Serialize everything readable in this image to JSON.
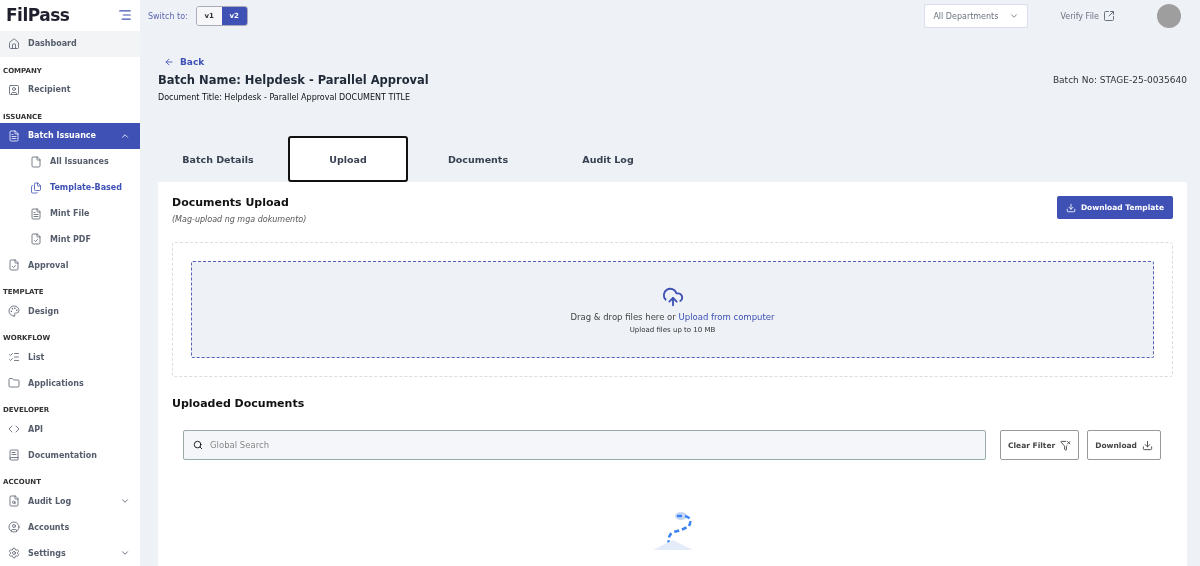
{
  "logo": {
    "text": "FilPass"
  },
  "sidebar": {
    "sections": [
      {
        "items": [
          {
            "label": "Dashboard",
            "selected": false,
            "hovered": true
          }
        ]
      },
      {
        "heading": "COMPANY",
        "items": [
          {
            "label": "Recipient",
            "selected": false
          }
        ]
      },
      {
        "heading": "ISSUANCE",
        "items": [
          {
            "label": "Batch Issuance",
            "selected": true,
            "expanded": true,
            "children": [
              {
                "label": "All Issuances",
                "selected": false
              },
              {
                "label": "Template-Based",
                "selected": true
              },
              {
                "label": "Mint File",
                "selected": false
              },
              {
                "label": "Mint PDF",
                "selected": false
              }
            ]
          },
          {
            "label": "Approval",
            "selected": false
          }
        ]
      },
      {
        "heading": "TEMPLATE",
        "items": [
          {
            "label": "Design",
            "selected": false
          }
        ]
      },
      {
        "heading": "WORKFLOW",
        "items": [
          {
            "label": "List",
            "selected": false
          },
          {
            "label": "Applications",
            "selected": false
          }
        ]
      },
      {
        "heading": "DEVELOPER",
        "items": [
          {
            "label": "API",
            "selected": false
          },
          {
            "label": "Documentation",
            "selected": false
          }
        ]
      },
      {
        "heading": "ACCOUNT",
        "items": [
          {
            "label": "Audit Log",
            "selected": false,
            "expanded": false
          },
          {
            "label": "Accounts",
            "selected": false
          },
          {
            "label": "Settings",
            "selected": false,
            "expanded": false
          }
        ]
      }
    ]
  },
  "topbar": {
    "switch_label": "Switch to:",
    "versions": [
      {
        "label": "v1",
        "selected": false
      },
      {
        "label": "v2",
        "selected": true
      }
    ],
    "department": {
      "value": "All Departments"
    },
    "verify_link": "Verify File"
  },
  "header": {
    "back": "Back",
    "batch_name": "Batch Name: Helpdesk - Parallel Approval",
    "document_title": "Document Title: Helpdesk - Parallel Approval DOCUMENT TITLE",
    "batch_no": "Batch No: STAGE-25-0035640"
  },
  "tabs": [
    {
      "label": "Batch Details",
      "selected": false
    },
    {
      "label": "Upload",
      "selected": true
    },
    {
      "label": "Documents",
      "selected": false
    },
    {
      "label": "Audit Log",
      "selected": false
    }
  ],
  "upload": {
    "title": "Documents Upload",
    "subtitle": "(Mag-upload ng mga dokumento)",
    "download_button": "Download Template",
    "drop_text": "Drag & drop files here or",
    "drop_link": "Upload from computer",
    "limit": "Upload files up to 10 MB"
  },
  "uploaded": {
    "title": "Uploaded Documents",
    "search": {
      "placeholder": "Global Search"
    },
    "clear_filter": "Clear Filter",
    "download": "Download"
  }
}
